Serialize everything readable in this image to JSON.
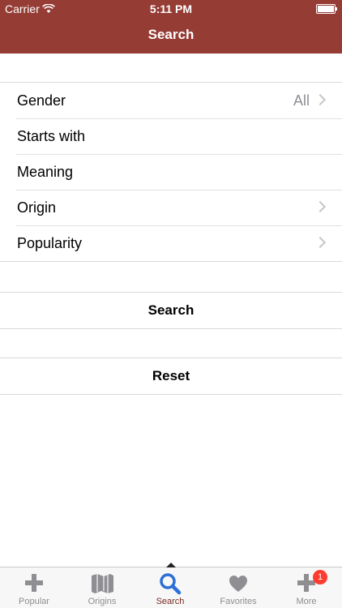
{
  "status_bar": {
    "carrier": "Carrier",
    "time": "5:11 PM"
  },
  "nav": {
    "title": "Search"
  },
  "criteria": [
    {
      "label": "Gender",
      "value": "All",
      "chevron": true
    },
    {
      "label": "Starts with",
      "value": "",
      "chevron": false
    },
    {
      "label": "Meaning",
      "value": "",
      "chevron": false
    },
    {
      "label": "Origin",
      "value": "",
      "chevron": true
    },
    {
      "label": "Popularity",
      "value": "",
      "chevron": true
    }
  ],
  "actions": {
    "search_label": "Search",
    "reset_label": "Reset"
  },
  "tabbar": {
    "tabs": [
      {
        "label": "Popular",
        "icon": "plus-icon"
      },
      {
        "label": "Origins",
        "icon": "map-icon"
      },
      {
        "label": "Search",
        "icon": "search-icon",
        "active": true
      },
      {
        "label": "Favorites",
        "icon": "heart-icon"
      },
      {
        "label": "More",
        "icon": "plus-icon",
        "badge": "1"
      }
    ]
  },
  "colors": {
    "header": "#953c34",
    "active_tab": "#2d6fd6",
    "badge": "#ff3b30"
  }
}
